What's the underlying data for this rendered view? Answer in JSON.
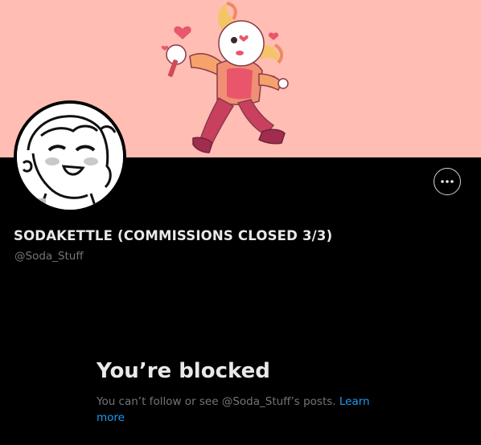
{
  "profile": {
    "display_name": "SODAKETTLE (COMMISSIONS CLOSED 3/3)",
    "handle": "@Soda_Stuff"
  },
  "icons": {
    "more": "more-options-icon",
    "banner": "character-illustration",
    "avatar": "sketch-avatar"
  },
  "blocked": {
    "title": "You’re blocked",
    "message": "You can’t follow or see @Soda_Stuff’s posts. ",
    "link_label": "Learn more"
  },
  "colors": {
    "background": "#000000",
    "banner": "#ffbdb3",
    "primary_text": "#e7e9ea",
    "secondary_text": "#71767b",
    "link": "#1d9bf0"
  }
}
